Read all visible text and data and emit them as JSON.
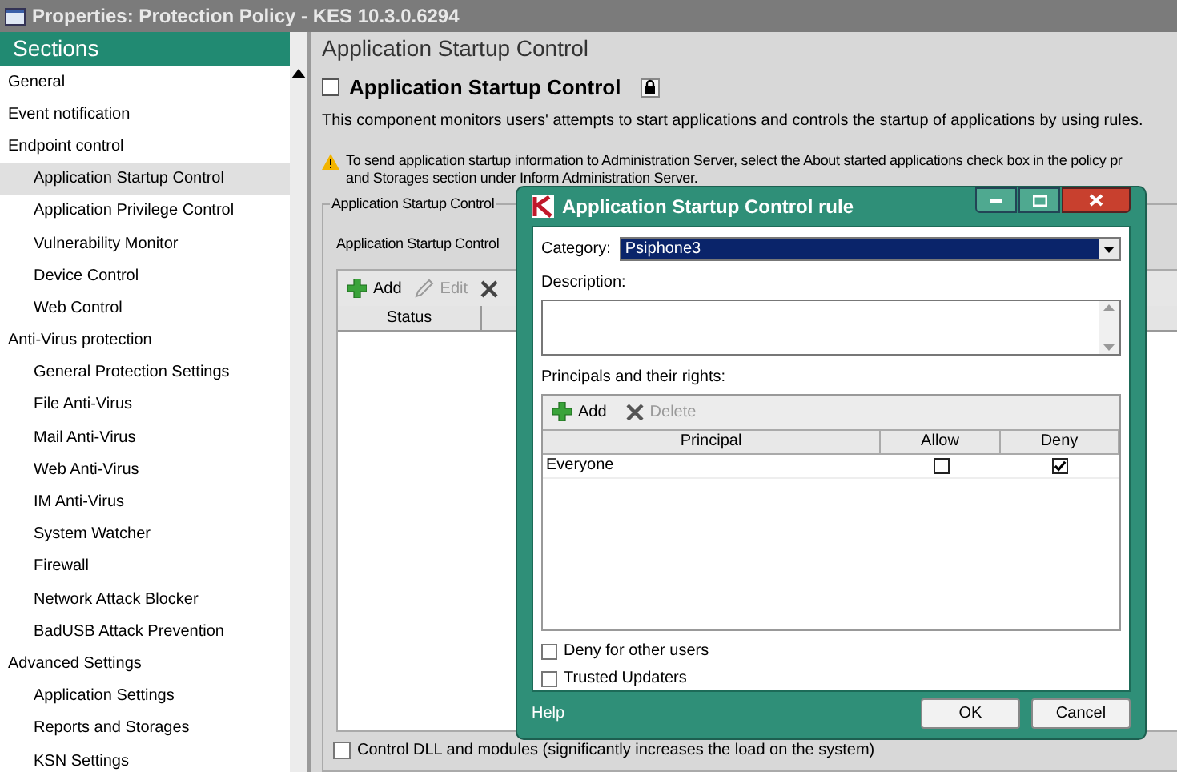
{
  "window": {
    "title": "Properties: Protection Policy - KES 10.3.0.6294"
  },
  "sidebar": {
    "title": "Sections",
    "items": [
      {
        "label": "General",
        "selected": false
      },
      {
        "label": "Event notification",
        "selected": false
      },
      {
        "label": "Endpoint control",
        "selected": false,
        "children": [
          {
            "label": "Application Startup Control",
            "selected": true
          },
          {
            "label": "Application Privilege Control",
            "selected": false
          },
          {
            "label": "Vulnerability Monitor",
            "selected": false
          },
          {
            "label": "Device Control",
            "selected": false
          },
          {
            "label": "Web Control",
            "selected": false
          }
        ]
      },
      {
        "label": "Anti-Virus protection",
        "selected": false,
        "children": [
          {
            "label": "General Protection Settings",
            "selected": false
          },
          {
            "label": "File Anti-Virus",
            "selected": false
          },
          {
            "label": "Mail Anti-Virus",
            "selected": false
          },
          {
            "label": "Web Anti-Virus",
            "selected": false
          },
          {
            "label": "IM Anti-Virus",
            "selected": false
          },
          {
            "label": "System Watcher",
            "selected": false
          },
          {
            "label": "Firewall",
            "selected": false
          },
          {
            "label": "Network Attack Blocker",
            "selected": false
          },
          {
            "label": "BadUSB Attack Prevention",
            "selected": false
          }
        ]
      },
      {
        "label": "Advanced Settings",
        "selected": false,
        "children": [
          {
            "label": "Application Settings",
            "selected": false
          },
          {
            "label": "Reports and Storages",
            "selected": false
          },
          {
            "label": "KSN Settings",
            "selected": false
          }
        ]
      }
    ]
  },
  "content": {
    "heading": "Application Startup Control",
    "enable": {
      "label": "Application Startup Control",
      "checked": false
    },
    "description": "This component monitors users' attempts to start applications and controls the startup of applications by using rules.",
    "warning": [
      "To send application startup information to Administration Server, select the About started applications check box in the policy pr",
      "and Storages section under Inform Administration Server."
    ],
    "group_label": "Application Startup Control",
    "mode_label": "Application Startup Control",
    "toolbar": [
      {
        "kind": "add",
        "label": "Add",
        "disabled": false
      },
      {
        "kind": "edit",
        "label": "Edit",
        "disabled": true
      },
      {
        "kind": "delete",
        "disabled": false
      }
    ],
    "table": {
      "columns": [
        "Status"
      ]
    },
    "dll_option": {
      "label": "Control DLL and modules (significantly increases the load on the system)",
      "checked": false
    }
  },
  "dialog": {
    "title": "Application Startup Control rule",
    "category": {
      "label": "Category:",
      "value": "Psiphone3"
    },
    "description": {
      "label": "Description:"
    },
    "principals": {
      "label": "Principals and their rights:",
      "toolbar": [
        {
          "kind": "add",
          "label": "Add",
          "disabled": false
        },
        {
          "kind": "delete",
          "label": "Delete",
          "disabled": true
        }
      ],
      "columns": [
        "Principal",
        "Allow",
        "Deny"
      ],
      "rows": [
        {
          "name": "Everyone",
          "allow": false,
          "deny": true
        }
      ]
    },
    "options": [
      {
        "label": "Deny for other users",
        "checked": false
      },
      {
        "label": "Trusted Updaters",
        "checked": false
      }
    ],
    "help": "Help",
    "buttons": [
      {
        "label": "OK"
      },
      {
        "label": "Cancel"
      }
    ]
  }
}
